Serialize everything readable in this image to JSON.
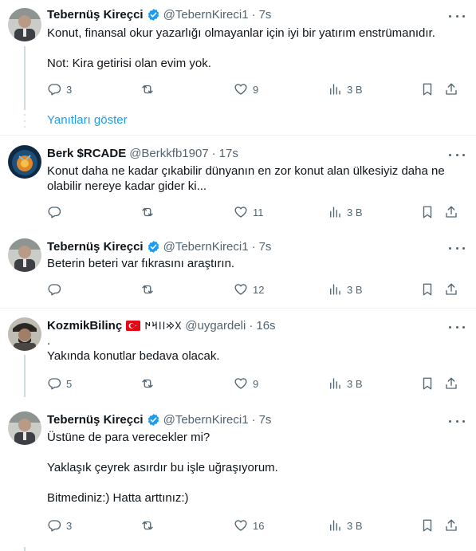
{
  "tweets": [
    {
      "name": "Tebernüş Kireçci",
      "handle": "@TebernKireci1",
      "time": "7s",
      "text": "Konut, finansal okur yazarlığı olmayanlar için iyi bir yatırım enstrümanıdır.\n\nNot: Kira getirisi olan evim yok.",
      "replies": "3",
      "retweets": "",
      "likes": "9",
      "views": "3 B"
    },
    {
      "name": "Berk $RCADE",
      "handle": "@Berkkfb1907",
      "time": "17s",
      "text": "Konut daha ne kadar çıkabilir dünyanın en zor konut alan ülkesiyiz daha ne olabilir nereye kadar gider ki...",
      "replies": "",
      "retweets": "",
      "likes": "11",
      "views": "3 B"
    },
    {
      "name": "Tebernüş Kireçci",
      "handle": "@TebernKireci1",
      "time": "7s",
      "text": "Beterin beteri var fıkrasını araştırın.",
      "replies": "",
      "retweets": "",
      "likes": "12",
      "views": "3 B"
    },
    {
      "name": "KozmikBilinç",
      "runes": "𐰓𐰢𐰾𐰾𐰺𐰇",
      "handle": "@uygardeli",
      "time": "16s",
      "text": ".\nYakında konutlar bedava olacak.",
      "replies": "5",
      "retweets": "",
      "likes": "9",
      "views": "3 B"
    },
    {
      "name": "Tebernüş Kireçci",
      "handle": "@TebernKireci1",
      "time": "7s",
      "text": "Üstüne de para verecekler mi?\n\nYaklaşık çeyrek asırdır bu işle uğraşıyorum.\n\nBitmediniz:) Hatta arttınız:)",
      "replies": "3",
      "retweets": "",
      "likes": "16",
      "views": "3 B"
    }
  ],
  "show_replies_label": "Yanıtları göster",
  "colors": {
    "accent": "#1d9bf0",
    "secondary_text": "#536471",
    "divider": "#eff3f4"
  },
  "icons": {
    "reply": "reply-icon",
    "retweet": "retweet-icon",
    "like": "heart-icon",
    "views": "views-icon",
    "bookmark": "bookmark-icon",
    "share": "share-icon",
    "more": "more-icon",
    "verified": "verified-badge-icon",
    "flag": "turkey-flag-icon"
  }
}
